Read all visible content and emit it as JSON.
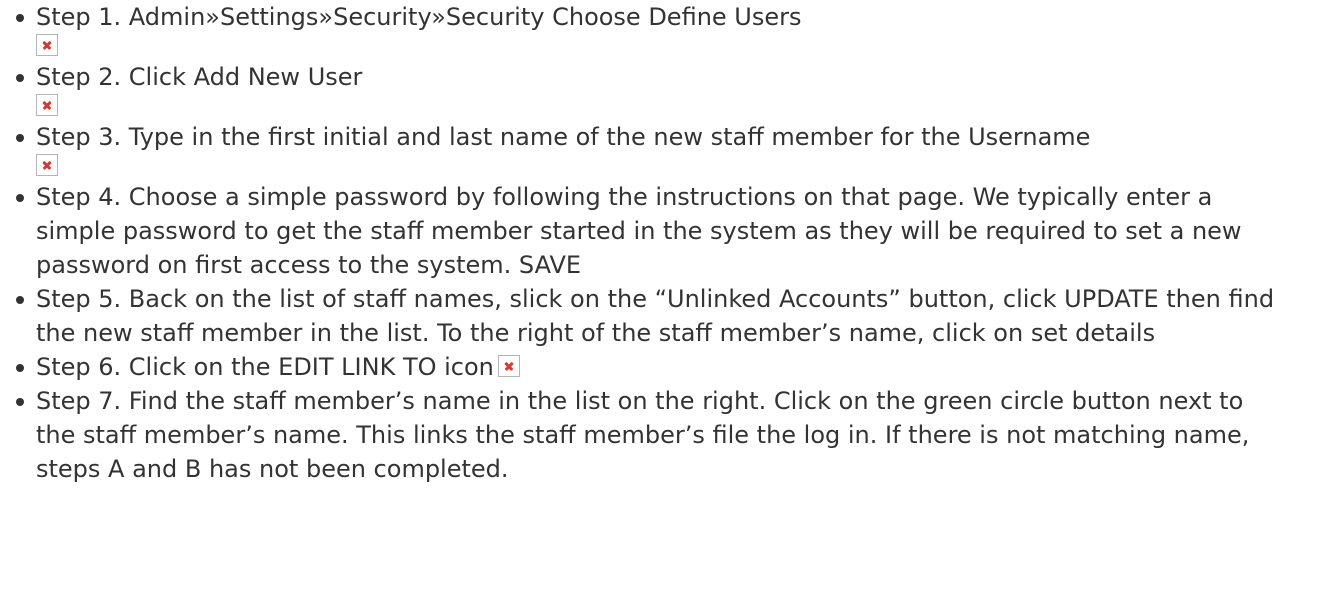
{
  "steps": [
    {
      "text": "Step 1. Admin»Settings»Security»Security Choose Define Users",
      "image": "block"
    },
    {
      "text": "Step 2. Click Add New User",
      "image": "block"
    },
    {
      "text": "Step 3. Type in the first initial and last name of the new staff member for the Username",
      "image": "block"
    },
    {
      "text": "Step 4. Choose a simple password by following the instructions on that page. We typically enter a simple password to get the staff member started in the system as they will be required to set a new password on first access to the system. SAVE"
    },
    {
      "text": "Step 5. Back on the list of staff names, slick on the “Unlinked Accounts” button, click UPDATE then find the new staff member in the list. To the right of the staff member’s name, click on set details"
    },
    {
      "text": "Step 6. Click on the EDIT LINK TO icon",
      "image": "inline"
    },
    {
      "text": "Step 7. Find the staff member’s name in the list on the right. Click on the green circle button next to the staff member’s name. This links the staff member’s file the log in. If there is not matching name, steps A and B has not been completed."
    }
  ],
  "icons": {
    "broken_image": "broken-image-icon",
    "bullet": "bullet-dot"
  },
  "colors": {
    "text": "#333333",
    "broken_image_x": "#d43b2c",
    "broken_image_border": "#b5b5b5"
  }
}
